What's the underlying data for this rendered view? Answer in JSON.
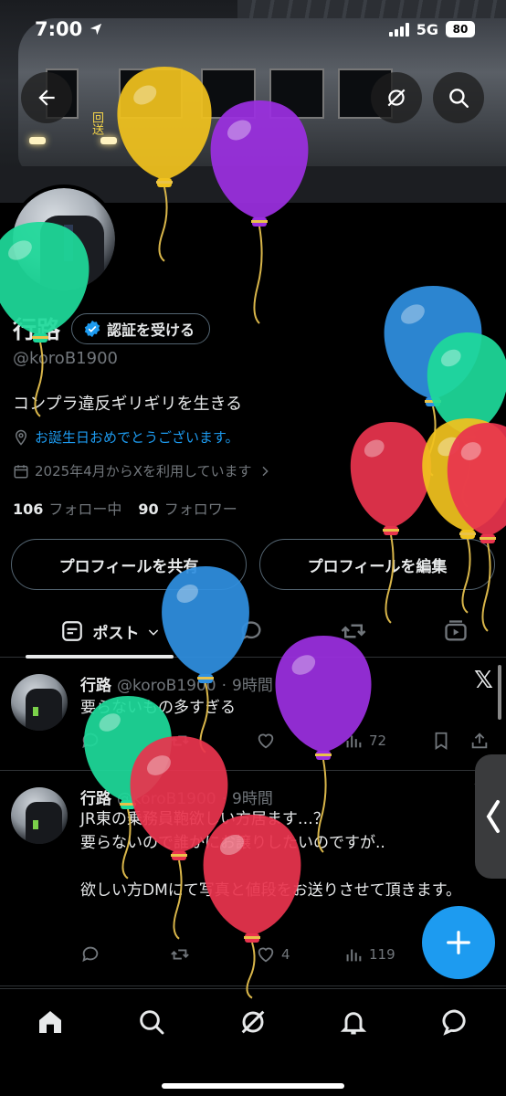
{
  "status_bar": {
    "time": "7:00",
    "network": "5G",
    "battery": "80"
  },
  "header": {
    "back_icon": "arrow-left-icon",
    "grok_icon": "grok-icon",
    "search_icon": "search-icon"
  },
  "banner": {
    "destination_sign": "回送"
  },
  "profile": {
    "display_name": "行路",
    "verify_button": "認証を受ける",
    "handle": "@koroB1900",
    "bio": "コンプラ違反ギリギリを生きる",
    "location": "お誕生日おめでとうございます。",
    "joined": "2025年4月からXを利用しています",
    "following_count": "106",
    "following_label": "フォロー中",
    "followers_count": "90",
    "followers_label": "フォロワー"
  },
  "buttons": {
    "share_profile": "プロフィールを共有",
    "edit_profile": "プロフィールを編集"
  },
  "tabs": {
    "posts_label": "ポスト"
  },
  "posts": [
    {
      "name": "行路",
      "handle": "@koroB1900",
      "time": "9時間",
      "text": "要らないもの多すぎる",
      "views": "72"
    },
    {
      "name": "行路",
      "handle": "@koroB1900",
      "time": "9時間",
      "text": "JR東の乗務員鞄欲しい方居ます…？\n要らないので誰かにお譲りしたいのですが..\n\n欲しい方DMにて写真と値段をお送りさせて頂きます。",
      "likes": "4",
      "views": "119"
    }
  ],
  "balloon_colors": [
    "#f0c21e",
    "#9b2fe0",
    "#1ed99a",
    "#2f8fe0",
    "#e8344e"
  ],
  "accent_color": "#1d9bf0"
}
